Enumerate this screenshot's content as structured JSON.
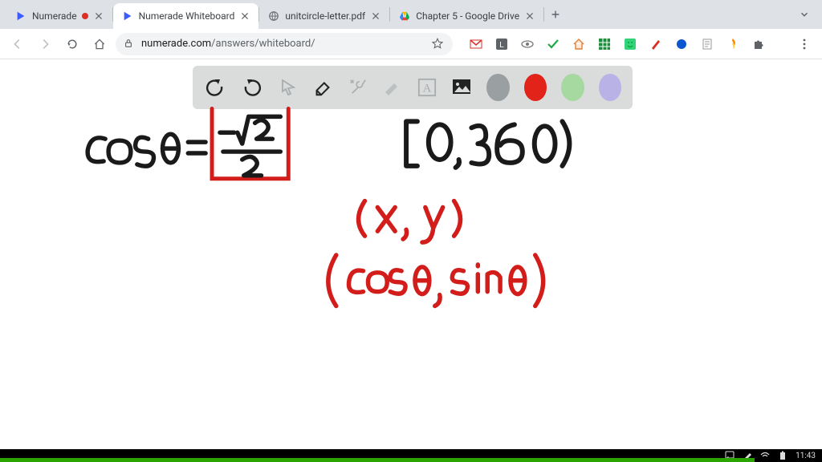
{
  "tabs": [
    {
      "title": "Numerade",
      "favicon": "numerade",
      "audio": true
    },
    {
      "title": "Numerade Whiteboard",
      "favicon": "numerade",
      "active": true
    },
    {
      "title": "unitcircle-letter.pdf",
      "favicon": "globe"
    },
    {
      "title": "Chapter 5 - Google Drive",
      "favicon": "drive"
    }
  ],
  "omnibox": {
    "host": "numerade.com",
    "path": "/answers/whiteboard/"
  },
  "extensions": [
    {
      "name": "gmail"
    },
    {
      "name": "lastpass"
    },
    {
      "name": "eye"
    },
    {
      "name": "check"
    },
    {
      "name": "house"
    },
    {
      "name": "grid-green"
    },
    {
      "name": "smiley"
    },
    {
      "name": "pen-red"
    },
    {
      "name": "circle-blue"
    },
    {
      "name": "page"
    },
    {
      "name": "flame"
    },
    {
      "name": "puzzle"
    }
  ],
  "whiteboard": {
    "tools": [
      {
        "name": "undo"
      },
      {
        "name": "redo"
      },
      {
        "name": "pointer",
        "muted": true
      },
      {
        "name": "eraser"
      },
      {
        "name": "wrench",
        "muted": true
      },
      {
        "name": "knife",
        "muted": true
      },
      {
        "name": "text-box",
        "muted": true
      },
      {
        "name": "image"
      }
    ],
    "colors": [
      {
        "name": "gray",
        "hex": "#9aa0a1"
      },
      {
        "name": "red",
        "hex": "#e2231a"
      },
      {
        "name": "green",
        "hex": "#a6d9a0"
      },
      {
        "name": "purple",
        "hex": "#b8b2e6"
      }
    ]
  },
  "handwriting": {
    "black_lines": [
      "cosθ = -√2 / 2",
      "[0, 360)"
    ],
    "red_lines": [
      "(x, y)",
      "(cosθ, sinθ)"
    ],
    "red_box_around": "-√2 / 2"
  },
  "statusbar": {
    "time": "11:43"
  }
}
